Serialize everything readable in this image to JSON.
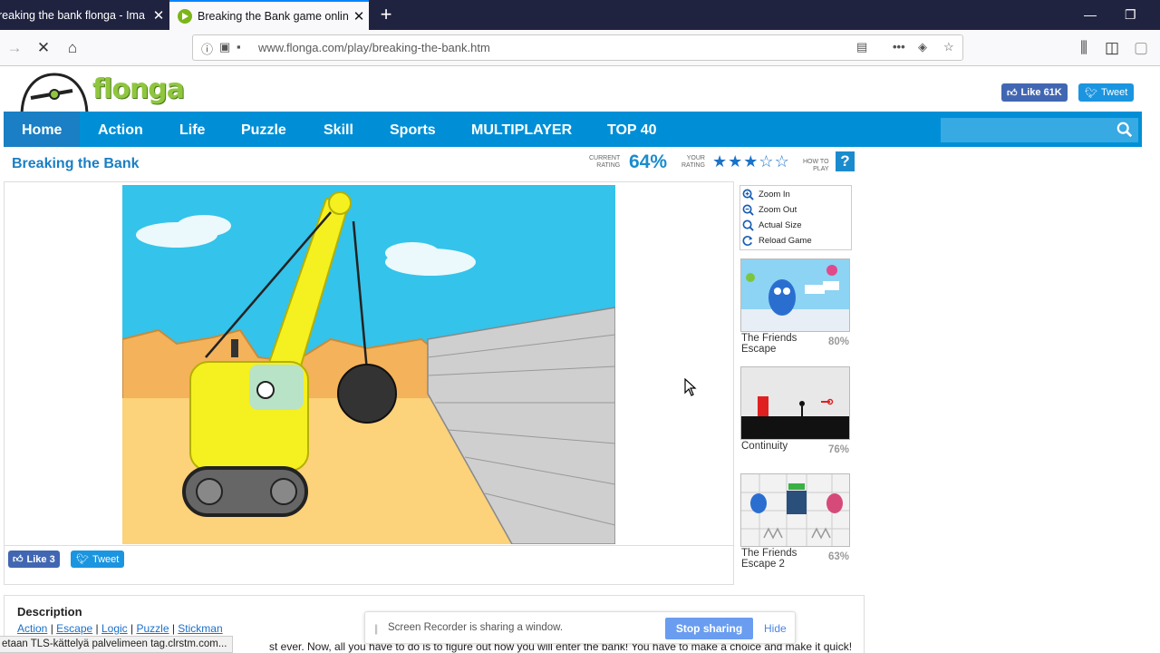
{
  "browser": {
    "tabs": [
      {
        "title": "reaking the bank flonga - Ima",
        "active": false
      },
      {
        "title": "Breaking the Bank game online",
        "active": true
      }
    ],
    "url": "www.flonga.com/play/breaking-the-bank.htm"
  },
  "site": {
    "logo_text": "flonga",
    "social": {
      "like_label": "Like 61K",
      "tweet_label": "Tweet"
    },
    "menu": [
      "Home",
      "Action",
      "Life",
      "Puzzle",
      "Skill",
      "Sports",
      "MULTIPLAYER",
      "TOP 40"
    ]
  },
  "game": {
    "title": "Breaking the Bank",
    "current_rating_label_1": "CURRENT",
    "current_rating_label_2": "RATING",
    "current_rating": "64%",
    "your_rating_label_1": "YOUR",
    "your_rating_label_2": "RATING",
    "your_rating_stars": 3,
    "max_stars": 5,
    "how_to_label_1": "HOW TO",
    "how_to_label_2": "PLAY",
    "help_label": "?",
    "share_like": "Like 3",
    "share_tweet": "Tweet"
  },
  "zoom_panel": {
    "zoom_in": "Zoom In",
    "zoom_out": "Zoom Out",
    "actual_size": "Actual Size",
    "reload": "Reload Game"
  },
  "related": [
    {
      "name": "The Friends Escape",
      "rating": "80%"
    },
    {
      "name": "Continuity",
      "rating": "76%"
    },
    {
      "name": "The Friends Escape 2",
      "rating": "63%"
    }
  ],
  "description": {
    "title": "Description",
    "tags": [
      "Action",
      "Escape",
      "Logic",
      "Puzzle",
      "Stickman"
    ],
    "text_fragment": "st ever. Now, all you have to do is to figure out how you will enter the bank! You have to make a choice and make it quick!"
  },
  "status_overlay": "etaan TLS-kättelyä palvelimeen tag.clrstm.com...",
  "screen_share": {
    "message": "Screen Recorder is sharing a window.",
    "stop_label": "Stop sharing",
    "hide_label": "Hide"
  },
  "colors": {
    "menu_blue": "#008fd6",
    "title_blue": "#1a7fc4",
    "brand_green": "#8fc63f",
    "sky": "#34c3ea",
    "crane_yellow": "#f5f020"
  }
}
